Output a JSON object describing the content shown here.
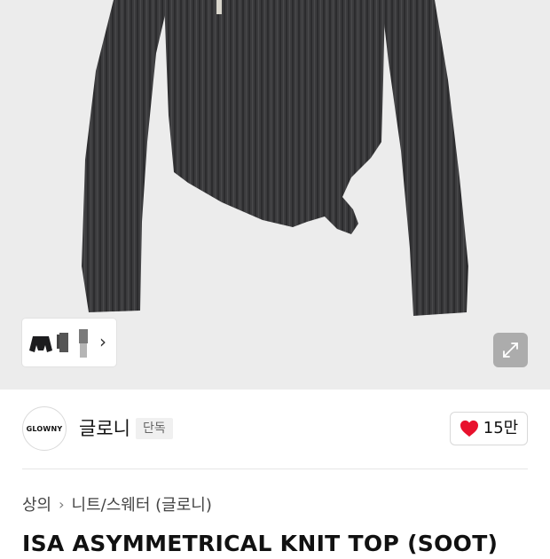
{
  "brand": {
    "logo_text": "GLOWNY",
    "name": "글로니",
    "badge": "단독"
  },
  "like": {
    "count": "15만",
    "icon": "heart-icon",
    "color": "#e8112d"
  },
  "breadcrumb": {
    "items": [
      "상의",
      "니트/스웨터 (글로니)"
    ],
    "separator_icon": "chevron-right-icon"
  },
  "product": {
    "title": "ISA ASYMMETRICAL KNIT TOP (SOOT)"
  },
  "gallery": {
    "thumbnails": [
      "sweater-front-thumbnail",
      "sweater-side-thumbnail",
      "sweater-model-thumbnail"
    ],
    "next_icon": "chevron-right-icon",
    "expand_icon": "expand-icon"
  },
  "colors": {
    "image_background": "#ececec",
    "knit": "#3a3a3c"
  }
}
